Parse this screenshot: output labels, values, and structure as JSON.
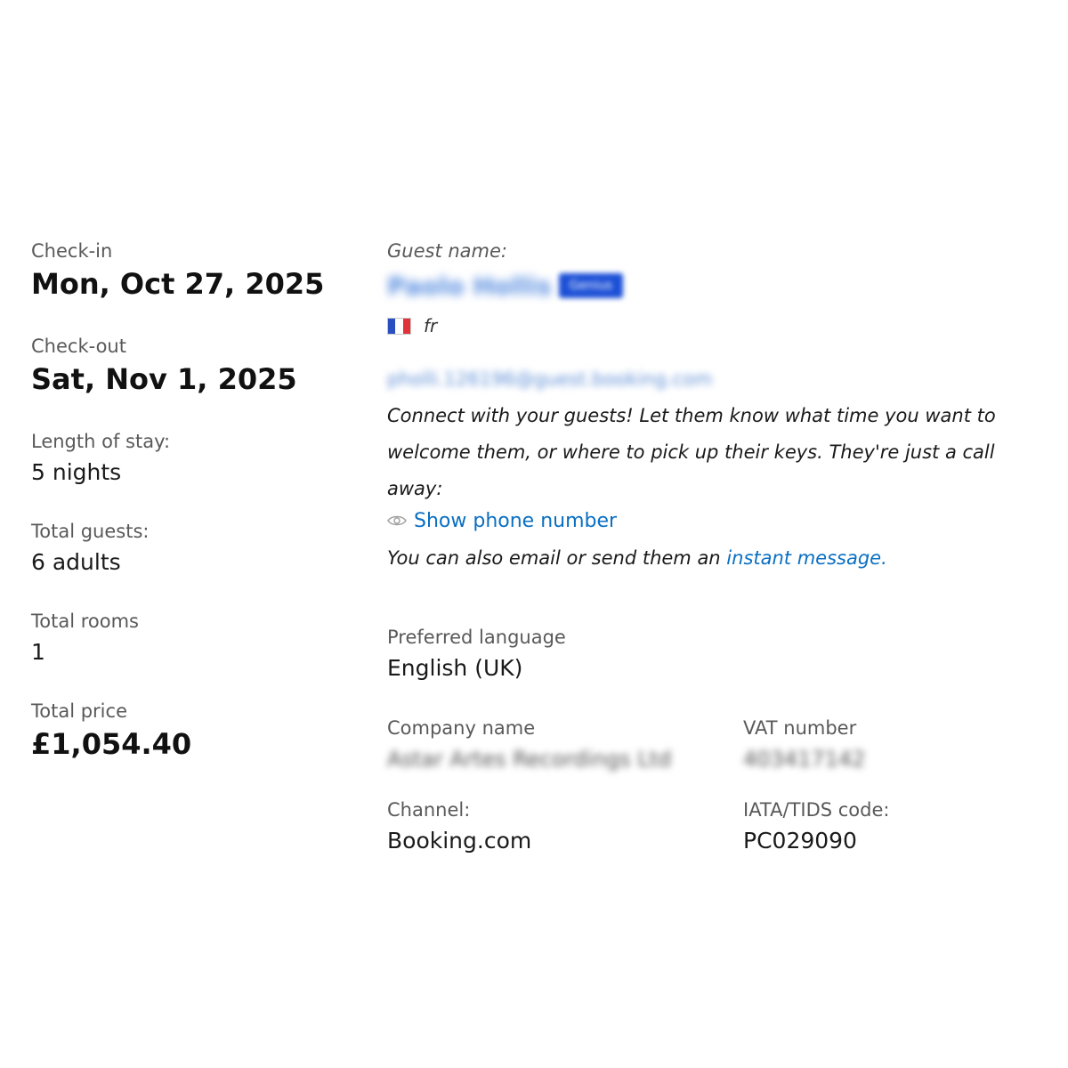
{
  "stay": {
    "checkin_label": "Check-in",
    "checkin_value": "Mon, Oct 27, 2025",
    "checkout_label": "Check-out",
    "checkout_value": "Sat, Nov 1, 2025",
    "length_label": "Length of stay:",
    "length_value": "5 nights",
    "guests_label": "Total guests:",
    "guests_value": "6 adults",
    "rooms_label": "Total rooms",
    "rooms_value": "1",
    "price_label": "Total price",
    "price_value": "£1,054.40"
  },
  "guest": {
    "name_label": "Guest name:",
    "name_value": "Paolo Hollis",
    "badge": "Genius",
    "flag_icon": "flag-france-icon",
    "language_code": "fr",
    "email": "pholli.126196@guest.booking.com",
    "connect_text": "Connect with your guests! Let them know what time you want to welcome them, or where to pick up their keys. They're just a call away:",
    "show_phone_label": "Show phone number",
    "eye_icon": "eye-icon",
    "also_text": "You can also email or send them an ",
    "instant_message_link": "instant message",
    "also_text_end": ".",
    "preferred_language_label": "Preferred language",
    "preferred_language_value": "English (UK)",
    "company_label": "Company name",
    "company_value": "Astar Artes Recordings Ltd",
    "vat_label": "VAT number",
    "vat_value": "403417142",
    "channel_label": "Channel:",
    "channel_value": "Booking.com",
    "iata_label": "IATA/TIDS code:",
    "iata_value": "PC029090"
  },
  "colors": {
    "link": "#0a6fc2",
    "badge": "#1b4fd6",
    "text": "#1a1a1a",
    "muted": "#595959"
  }
}
